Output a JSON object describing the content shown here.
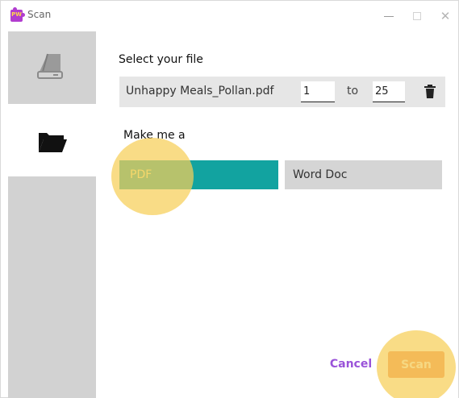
{
  "window": {
    "title": "Scan",
    "app_icon_text": "PW",
    "minimize_icon": "minimize-icon",
    "maximize_icon": "maximize-icon",
    "close_icon": "close-icon",
    "close_glyph": "✕"
  },
  "sidebar": {
    "items": [
      {
        "id": "scan",
        "icon": "scanner-icon",
        "active": false
      },
      {
        "id": "files",
        "icon": "folder-icon",
        "active": true
      }
    ]
  },
  "main": {
    "select_label": "Select your file",
    "file": {
      "name": "Unhappy Meals_Pollan.pdf",
      "page_from": "1",
      "to_label": "to",
      "page_to": "25",
      "delete_icon": "trash-icon"
    },
    "make_label": "Make me a",
    "options": [
      {
        "label": "PDF",
        "selected": true
      },
      {
        "label": "Word Doc",
        "selected": false
      }
    ],
    "cancel_label": "Cancel",
    "scan_label": "Scan"
  },
  "colors": {
    "selected_option": "#12a3a0",
    "unselected_option": "#d5d5d5",
    "cancel_text": "#9a53d9",
    "scan_button": "#ec8a5a",
    "highlight": "#f7cf58",
    "sidebar": "#d2d2d2",
    "app_icon": "#b13ccf"
  }
}
